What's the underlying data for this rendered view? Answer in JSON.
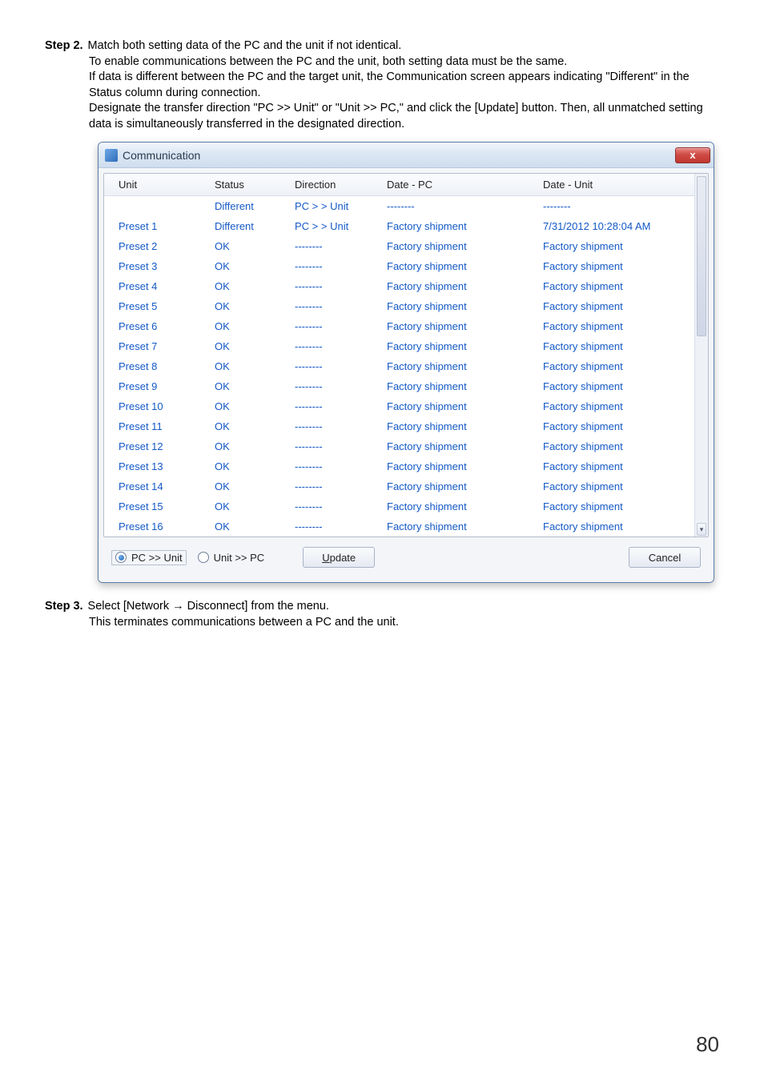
{
  "step2": {
    "label": "Step 2.",
    "first": "Match both setting data of the PC and the unit if not identical.",
    "p1": "To enable communications between the PC and the unit, both setting data must be the same.",
    "p2": "If data is different between the PC and the target unit, the Communication screen appears indicating \"Different\" in the Status column during connection.",
    "p3": "Designate the transfer direction \"PC >> Unit\" or \"Unit >> PC,\" and click the [Update] button. Then, all unmatched setting data is simultaneously transferred in the designated direction."
  },
  "step3": {
    "label": "Step 3.",
    "first": "Select [Network → Disconnect] from the menu.",
    "p1": "This terminates communications between a PC and the unit."
  },
  "window": {
    "title": "Communication",
    "close": "x",
    "headers": {
      "c0": "Unit",
      "c1": "Status",
      "c2": "Direction",
      "c3": "Date - PC",
      "c4": "Date - Unit"
    },
    "rows": [
      {
        "unit": "",
        "status": "Different",
        "direction": "PC > > Unit",
        "pc": "--------",
        "u": "--------"
      },
      {
        "unit": "Preset 1",
        "status": "Different",
        "direction": "PC > > Unit",
        "pc": "Factory shipment",
        "u": "7/31/2012 10:28:04 AM"
      },
      {
        "unit": "Preset 2",
        "status": "OK",
        "direction": "--------",
        "pc": "Factory shipment",
        "u": "Factory shipment"
      },
      {
        "unit": "Preset 3",
        "status": "OK",
        "direction": "--------",
        "pc": "Factory shipment",
        "u": "Factory shipment"
      },
      {
        "unit": "Preset 4",
        "status": "OK",
        "direction": "--------",
        "pc": "Factory shipment",
        "u": "Factory shipment"
      },
      {
        "unit": "Preset 5",
        "status": "OK",
        "direction": "--------",
        "pc": "Factory shipment",
        "u": "Factory shipment"
      },
      {
        "unit": "Preset 6",
        "status": "OK",
        "direction": "--------",
        "pc": "Factory shipment",
        "u": "Factory shipment"
      },
      {
        "unit": "Preset 7",
        "status": "OK",
        "direction": "--------",
        "pc": "Factory shipment",
        "u": "Factory shipment"
      },
      {
        "unit": "Preset 8",
        "status": "OK",
        "direction": "--------",
        "pc": "Factory shipment",
        "u": "Factory shipment"
      },
      {
        "unit": "Preset 9",
        "status": "OK",
        "direction": "--------",
        "pc": "Factory shipment",
        "u": "Factory shipment"
      },
      {
        "unit": "Preset 10",
        "status": "OK",
        "direction": "--------",
        "pc": "Factory shipment",
        "u": "Factory shipment"
      },
      {
        "unit": "Preset 11",
        "status": "OK",
        "direction": "--------",
        "pc": "Factory shipment",
        "u": "Factory shipment"
      },
      {
        "unit": "Preset 12",
        "status": "OK",
        "direction": "--------",
        "pc": "Factory shipment",
        "u": "Factory shipment"
      },
      {
        "unit": "Preset 13",
        "status": "OK",
        "direction": "--------",
        "pc": "Factory shipment",
        "u": "Factory shipment"
      },
      {
        "unit": "Preset 14",
        "status": "OK",
        "direction": "--------",
        "pc": "Factory shipment",
        "u": "Factory shipment"
      },
      {
        "unit": "Preset 15",
        "status": "OK",
        "direction": "--------",
        "pc": "Factory shipment",
        "u": "Factory shipment"
      },
      {
        "unit": "Preset 16",
        "status": "OK",
        "direction": "--------",
        "pc": "Factory shipment",
        "u": "Factory shipment"
      }
    ],
    "radio_pc_unit": "PC >> Unit",
    "radio_unit_pc": "Unit >> PC",
    "update_u": "U",
    "update_rest": "pdate",
    "cancel": "Cancel"
  },
  "page_number": "80"
}
